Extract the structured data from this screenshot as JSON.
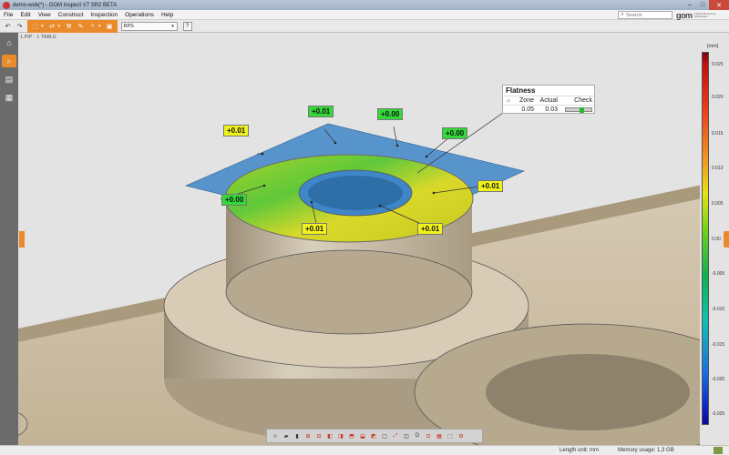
{
  "window": {
    "title": "demo-web(*) - GOM Inspect V7 SR2 BETA",
    "btn_min": "–",
    "btn_max": "□",
    "btn_close": "✕"
  },
  "menu": [
    "File",
    "Edit",
    "View",
    "Construct",
    "Inspection",
    "Operations",
    "Help"
  ],
  "search": {
    "placeholder": "Search"
  },
  "logo": {
    "brand": "gom",
    "tagline_1": "Optical Measuring",
    "tagline_2": "Techniques"
  },
  "toolbar": {
    "alignment_select": "RPS",
    "help": "?"
  },
  "breadcrumb": "1.PIP · 1 TABLE",
  "flatness": {
    "title": "Flatness",
    "symbol": "▱",
    "headers": {
      "zone": "Zone",
      "actual": "Actual",
      "check": "Check"
    },
    "values": {
      "zone": "0.05",
      "actual": "0.03"
    },
    "check_fraction": 0.6,
    "check_color": "#2cb52c"
  },
  "labels": [
    {
      "text": "+0.01",
      "color": "yellow"
    },
    {
      "text": "+0.01",
      "color": "green"
    },
    {
      "text": "+0.00",
      "color": "green"
    },
    {
      "text": "+0.00",
      "color": "green"
    },
    {
      "text": "+0.01",
      "color": "yellow"
    },
    {
      "text": "+0.00",
      "color": "green"
    },
    {
      "text": "+0.01",
      "color": "yellow"
    },
    {
      "text": "+0.01",
      "color": "yellow"
    }
  ],
  "colorbar": {
    "unit": "[mm]",
    "ticks": [
      "0.025",
      "0.020",
      "0.015",
      "0.010",
      "0.005",
      "0.00",
      "-0.005",
      "-0.010",
      "-0.015",
      "-0.020",
      "-0.025"
    ]
  },
  "status": {
    "length_unit": "Length unit: mm",
    "memory": "Memory usage: 1,3 GB"
  },
  "colors": {
    "accent": "#e98a2b",
    "yellow_label": "#f0f21a",
    "green_label": "#34d83a",
    "plane": "#3f86c8"
  }
}
